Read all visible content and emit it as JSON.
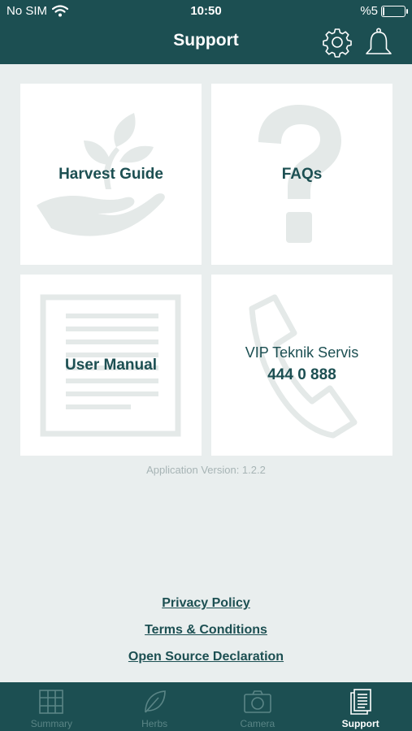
{
  "status_bar": {
    "carrier": "No SIM",
    "time": "10:50",
    "battery": "%5"
  },
  "header": {
    "title": "Support",
    "icons": [
      "gear-icon",
      "bell-icon"
    ]
  },
  "tiles": {
    "harvest_guide": {
      "label": "Harvest Guide",
      "icon": "plant-in-hand-icon"
    },
    "faqs": {
      "label": "FAQs",
      "icon": "question-mark-icon"
    },
    "user_manual": {
      "label": "User Manual",
      "icon": "document-icon"
    },
    "vip": {
      "line1": "VIP Teknik Servis",
      "phone": "444 0 888",
      "icon": "phone-icon"
    }
  },
  "version": "Application Version: 1.2.2",
  "links": {
    "privacy": "Privacy Policy",
    "terms": "Terms & Conditions",
    "open_source": "Open Source Declaration"
  },
  "tabbar": {
    "items": [
      {
        "label": "Summary",
        "icon": "summary-icon"
      },
      {
        "label": "Herbs",
        "icon": "leaf-icon"
      },
      {
        "label": "Camera",
        "icon": "camera-icon"
      },
      {
        "label": "Support",
        "icon": "support-document-icon"
      }
    ],
    "active": "Support"
  },
  "colors": {
    "primary": "#1c4f52",
    "background": "#e9eeee",
    "tile": "#ffffff",
    "watermark": "#e4e9e8"
  }
}
